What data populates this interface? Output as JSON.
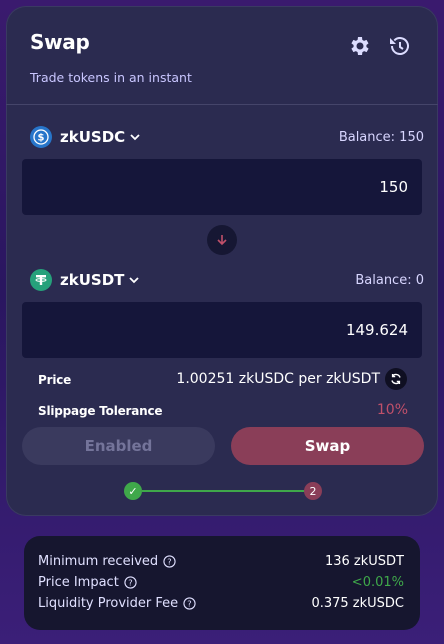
{
  "header": {
    "title": "Swap",
    "subtitle": "Trade tokens in an instant",
    "icons": [
      "settings-gear",
      "history-clock"
    ]
  },
  "from": {
    "token": "zkUSDC",
    "balance": "Balance: 150",
    "amount": "150"
  },
  "to": {
    "token": "zkUSDT",
    "balance": "Balance: 0",
    "amount": "149.624"
  },
  "price": {
    "label": "Price",
    "value": "1.00251 zkUSDC per zkUSDT"
  },
  "slippage": {
    "label": "Slippage Tolerance",
    "value": "10%"
  },
  "buttons": {
    "enabled": "Enabled",
    "swap": "Swap"
  },
  "steps": {
    "step1": "✓",
    "step2": "2"
  },
  "summary": {
    "min_received_label": "Minimum received",
    "min_received_value": "136 zkUSDT",
    "price_impact_label": "Price Impact",
    "price_impact_value": "<0.01%",
    "lp_fee_label": "Liquidity Provider Fee",
    "lp_fee_value": "0.375 zkUSDC"
  },
  "colors": {
    "accent_swap": "#8a3e58",
    "slippage": "#c0506a",
    "positive": "#3fa84a",
    "usdc_blue": "#2775ca",
    "usdt_green": "#26a17b"
  }
}
